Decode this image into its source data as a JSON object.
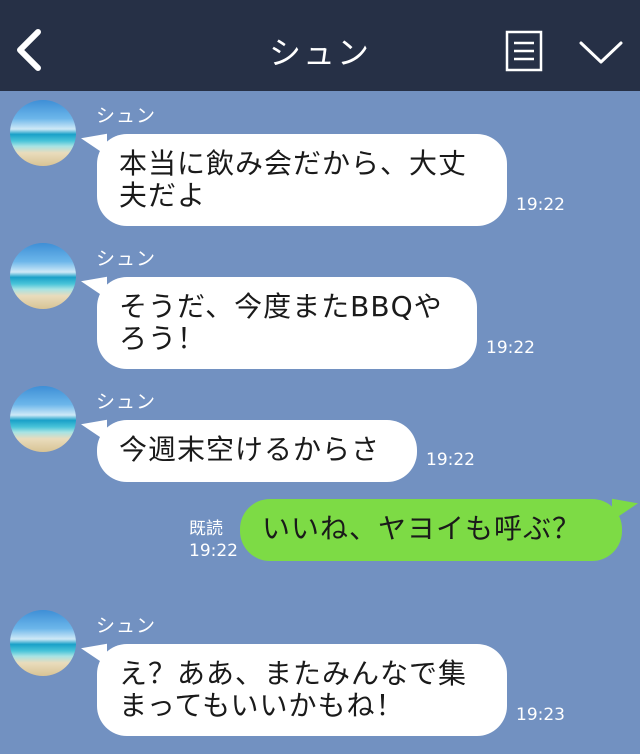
{
  "header": {
    "title": "シュン",
    "back_icon": "back-chevron-icon",
    "memo_icon": "memo-list-icon",
    "menu_icon": "chevron-down-icon"
  },
  "messages": [
    {
      "sender": "シュン",
      "lines": [
        "本当に飲み会だから、大丈",
        "夫だよ"
      ],
      "time": "19:22"
    },
    {
      "sender": "シュン",
      "lines": [
        "そうだ、今度またBBQや",
        "ろう！"
      ],
      "time": "19:22"
    },
    {
      "sender": "シュン",
      "lines": [
        "今週末空けるからさ"
      ],
      "time": "19:22"
    },
    {
      "lines": [
        "いいね、ヤヨイも呼ぶ？"
      ],
      "read": "既読",
      "time": "19:22"
    },
    {
      "sender": "シュン",
      "lines": [
        "え？ああ、またみんなで集",
        "まってもいいかもね！"
      ],
      "time": "19:23"
    }
  ],
  "colors": {
    "background": "#7291c1",
    "header": "#263046",
    "incoming_bubble": "#ffffff",
    "outgoing_bubble": "#7ddb45"
  }
}
